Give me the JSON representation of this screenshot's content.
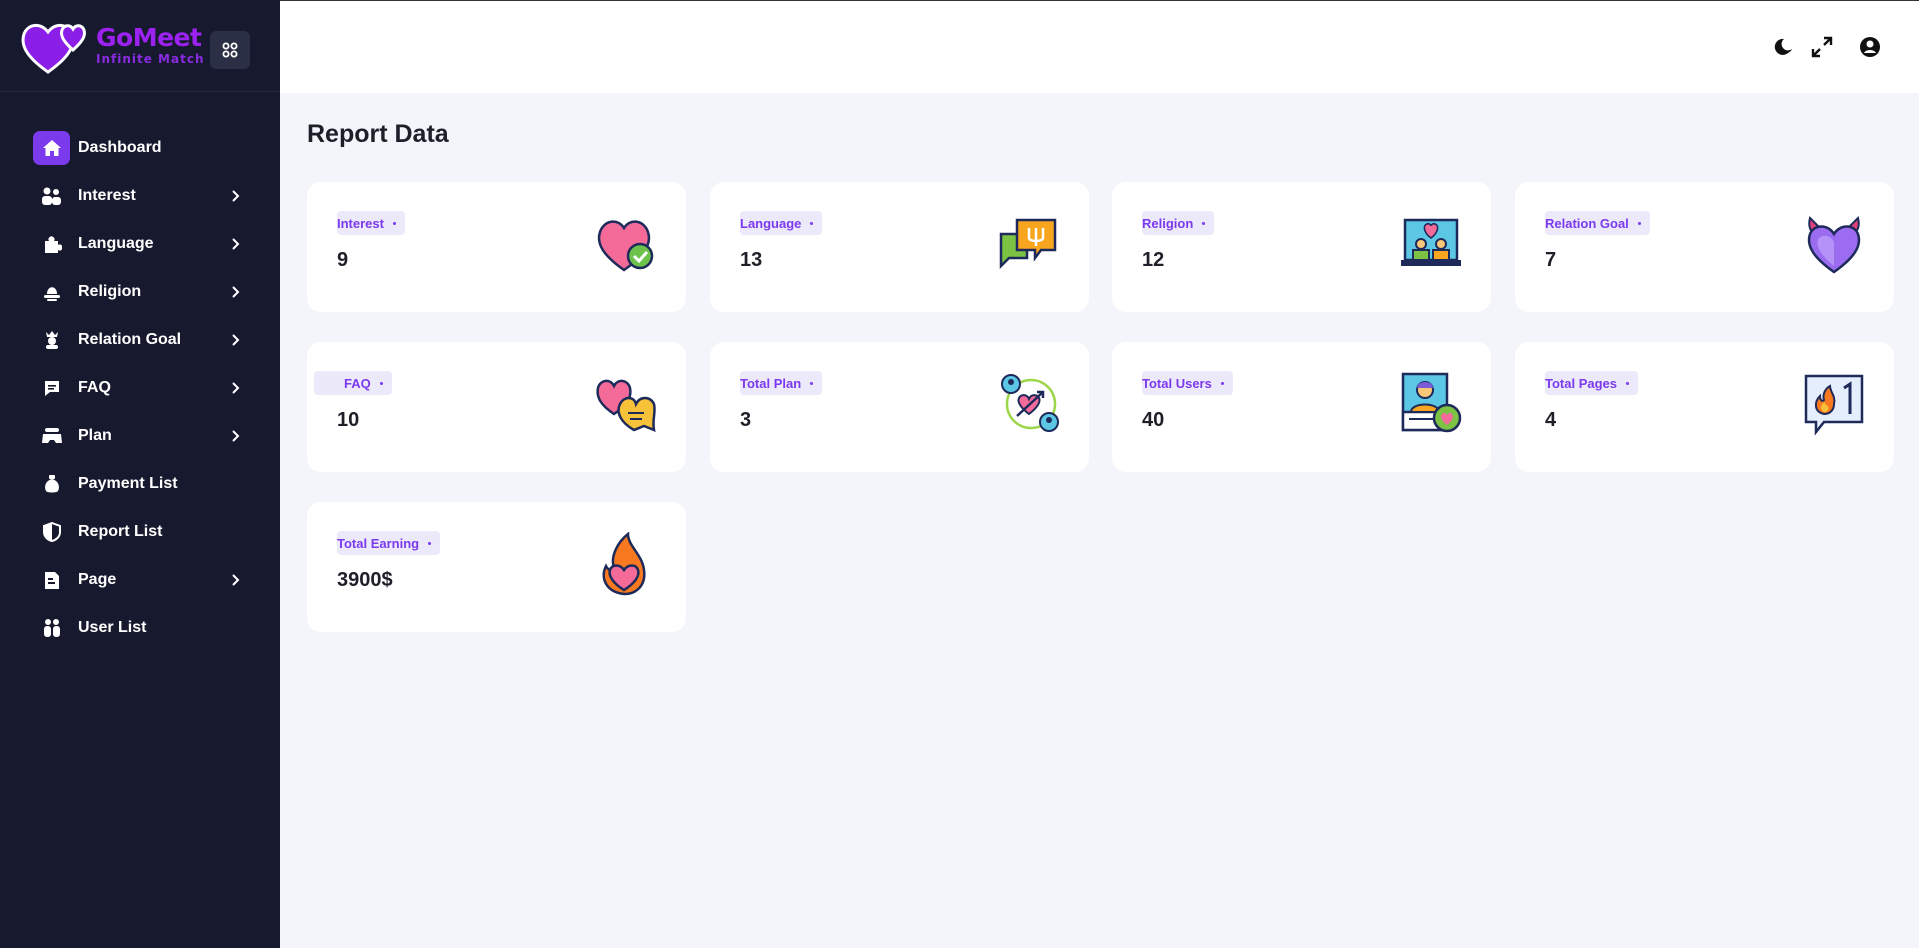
{
  "brand": {
    "name": "GoMeet",
    "tagline": "Infinite Match"
  },
  "sidebar": {
    "items": [
      {
        "label": "Dashboard",
        "icon": "home-icon",
        "active": true,
        "has_submenu": false
      },
      {
        "label": "Interest",
        "icon": "users-icon",
        "active": false,
        "has_submenu": true
      },
      {
        "label": "Language",
        "icon": "puzzle-icon",
        "active": false,
        "has_submenu": true
      },
      {
        "label": "Religion",
        "icon": "hat-icon",
        "active": false,
        "has_submenu": true
      },
      {
        "label": "Relation Goal",
        "icon": "crown-person-icon",
        "active": false,
        "has_submenu": true
      },
      {
        "label": "FAQ",
        "icon": "message-icon",
        "active": false,
        "has_submenu": true
      },
      {
        "label": "Plan",
        "icon": "gamepad-icon",
        "active": false,
        "has_submenu": true
      },
      {
        "label": "Payment List",
        "icon": "money-bag-icon",
        "active": false,
        "has_submenu": false
      },
      {
        "label": "Report List",
        "icon": "shield-half-icon",
        "active": false,
        "has_submenu": false
      },
      {
        "label": "Page",
        "icon": "page-icon",
        "active": false,
        "has_submenu": true
      },
      {
        "label": "User List",
        "icon": "user-group-icon",
        "active": false,
        "has_submenu": false
      }
    ]
  },
  "topbar": {
    "icons": [
      "moon-icon",
      "expand-icon",
      "user-circle-icon"
    ]
  },
  "main": {
    "title": "Report Data",
    "cards": [
      {
        "label": "Interest",
        "value": "9",
        "icon": "heart-check-icon"
      },
      {
        "label": "Language",
        "value": "13",
        "icon": "chat-bubbles-icon"
      },
      {
        "label": "Religion",
        "value": "12",
        "icon": "laptop-couple-icon"
      },
      {
        "label": "Relation Goal",
        "value": "7",
        "icon": "devil-heart-icon"
      },
      {
        "label": "FAQ",
        "value": "10",
        "icon": "heart-chat-icon"
      },
      {
        "label": "Total Plan",
        "value": "3",
        "icon": "match-people-icon"
      },
      {
        "label": "Total Users",
        "value": "40",
        "icon": "profile-heart-icon"
      },
      {
        "label": "Total Pages",
        "value": "4",
        "icon": "fire-notification-icon"
      },
      {
        "label": "Total Earning",
        "value": "3900$",
        "icon": "fire-heart-icon"
      }
    ]
  },
  "colors": {
    "sidebar_bg": "#171a2e",
    "accent": "#7c3aed",
    "page_bg": "#f4f5fa",
    "brand": "#9b22f0"
  }
}
